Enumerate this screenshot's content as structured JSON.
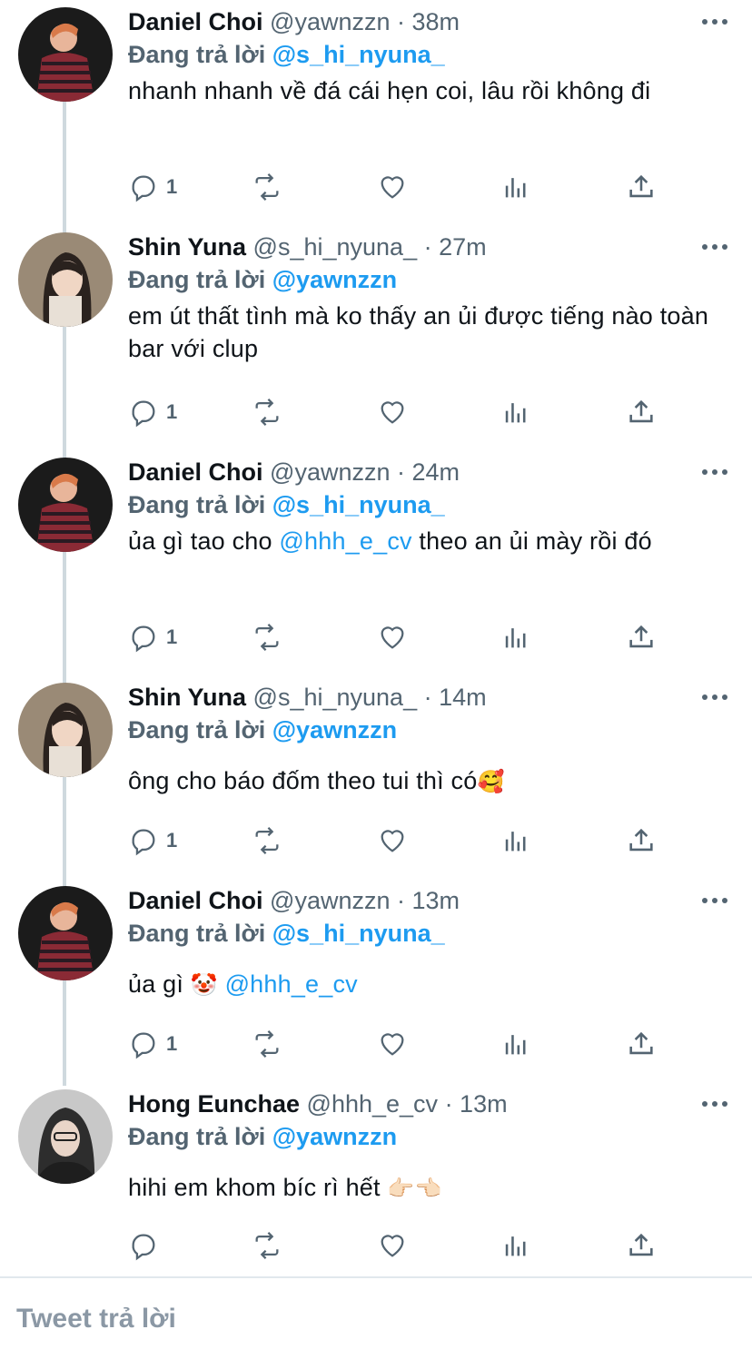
{
  "reply_prefix": "Đang trả lời",
  "tweets": [
    {
      "name": "Daniel Choi",
      "handle": "@yawnzzn",
      "time": "· 38m",
      "reply_to": "@s_hi_nyuna_",
      "text": "nhanh nhanh về đá cái hẹn coi, lâu rồi không đi",
      "replies": "1"
    },
    {
      "name": "Shin Yuna",
      "handle": "@s_hi_nyuna_",
      "time": "· 27m",
      "reply_to": "@yawnzzn",
      "text": "em út thất tình mà ko thấy an ủi được tiếng nào toàn bar với clup",
      "replies": "1"
    },
    {
      "name": "Daniel Choi",
      "handle": "@yawnzzn",
      "time": "· 24m",
      "reply_to": "@s_hi_nyuna_",
      "text_pre": "ủa gì tao cho ",
      "text_mention": "@hhh_e_cv",
      "text_post": " theo an ủi mày rồi đó",
      "replies": "1"
    },
    {
      "name": "Shin Yuna",
      "handle": "@s_hi_nyuna_",
      "time": "· 14m",
      "reply_to": "@yawnzzn",
      "text": "ông cho báo đốm theo tui thì có",
      "emoji": "🥰",
      "replies": "1"
    },
    {
      "name": "Daniel Choi",
      "handle": "@yawnzzn",
      "time": "· 13m",
      "reply_to": "@s_hi_nyuna_",
      "text_pre": "ủa gì ",
      "emoji": "🤡",
      "text_mention": "@hhh_e_cv",
      "replies": "1"
    },
    {
      "name": "Hong Eunchae",
      "handle": "@hhh_e_cv",
      "time": "· 13m",
      "reply_to": "@yawnzzn",
      "text": "hihi em khom bíc rì hết",
      "emoji": "👉🏻👈🏻",
      "replies": ""
    }
  ],
  "compose_placeholder": "Tweet trả lời",
  "colors": {
    "accent": "#1d9bf0",
    "muted": "#536471",
    "thread": "#cfd9de"
  }
}
